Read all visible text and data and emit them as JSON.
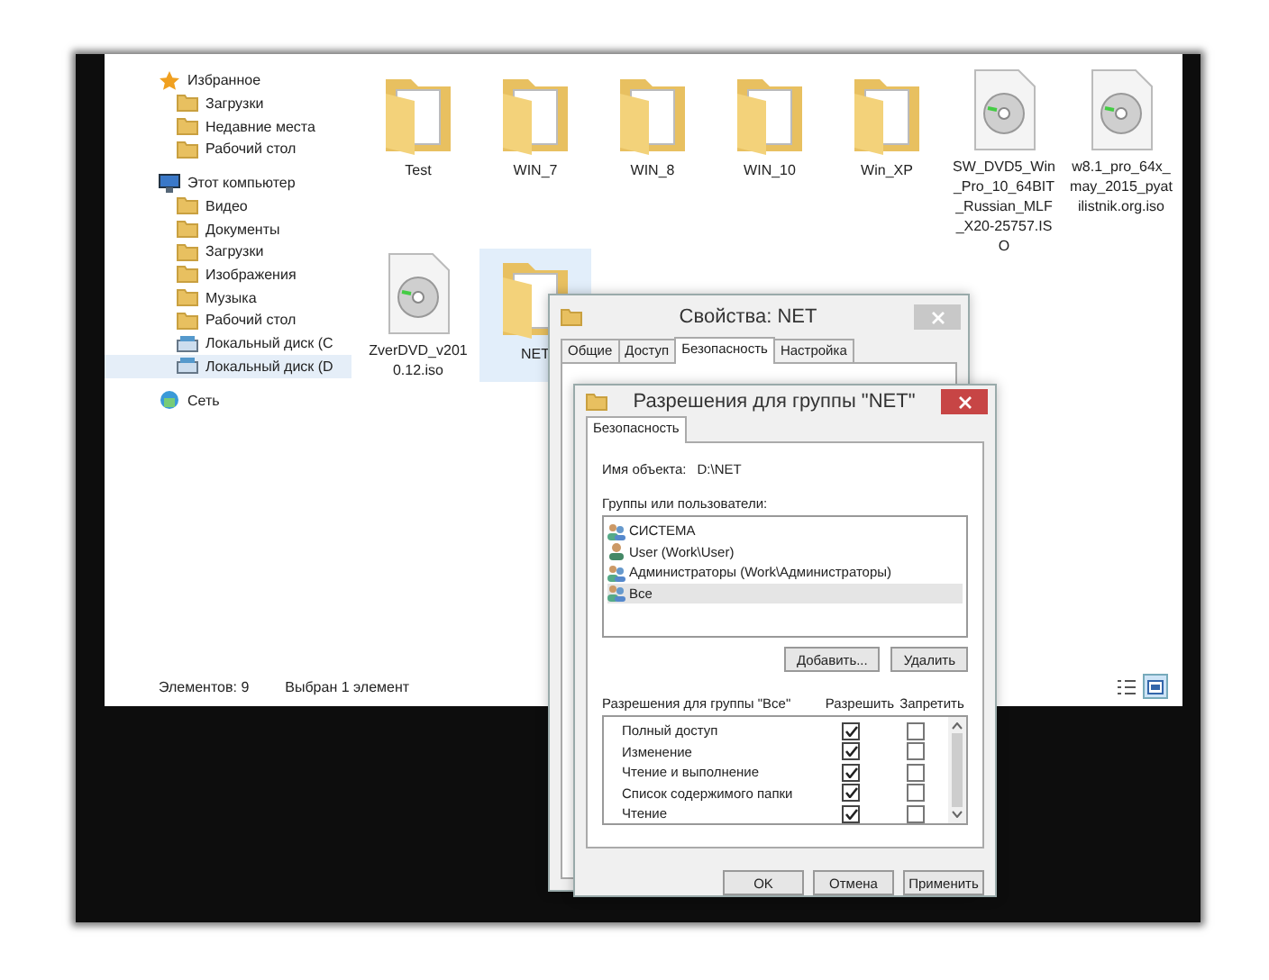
{
  "explorer": {
    "sidebar": [
      {
        "label": "Избранное",
        "children": [
          {
            "label": "Загрузки",
            "kind": "folder",
            "selected": false
          },
          {
            "label": "Недавние места",
            "kind": "folder",
            "selected": false
          },
          {
            "label": "Рабочий стол",
            "kind": "folder",
            "selected": false
          }
        ]
      },
      {
        "label": "Этот компьютер",
        "children": [
          {
            "label": "Видео",
            "kind": "folder",
            "selected": false
          },
          {
            "label": "Документы",
            "kind": "folder",
            "selected": false
          },
          {
            "label": "Загрузки",
            "kind": "folder",
            "selected": false
          },
          {
            "label": "Изображения",
            "kind": "folder",
            "selected": false
          },
          {
            "label": "Музыка",
            "kind": "folder",
            "selected": false
          },
          {
            "label": "Рабочий стол",
            "kind": "folder",
            "selected": false
          },
          {
            "label": "Локальный диск (C",
            "kind": "drive",
            "selected": false
          },
          {
            "label": "Локальный диск (D",
            "kind": "drive",
            "selected": true
          }
        ]
      },
      {
        "label": "Сеть"
      }
    ],
    "files": [
      {
        "name": "Test",
        "kind": "folder",
        "selected": false
      },
      {
        "name": "WIN_7",
        "kind": "folder",
        "selected": false
      },
      {
        "name": "WIN_8",
        "kind": "folder",
        "selected": false
      },
      {
        "name": "WIN_10",
        "kind": "folder",
        "selected": false
      },
      {
        "name": "Win_XP",
        "kind": "folder",
        "selected": false
      },
      {
        "name": "SW_DVD5_Win_Pro_10_64BIT_Russian_MLF_X20-25757.ISO",
        "kind": "disc",
        "selected": false
      },
      {
        "name": "w8.1_pro_64x_may_2015_pyatilistnik.org.iso",
        "kind": "disc",
        "selected": false
      },
      {
        "name": "ZverDVD_v2010.12.iso",
        "kind": "disc",
        "selected": false
      },
      {
        "name": "NET",
        "kind": "folder",
        "selected": true
      }
    ],
    "status_bar": {
      "count": "Элементов: 9",
      "selection": "Выбран 1 элемент"
    }
  },
  "properties_dialog": {
    "title": "Свойства: NET",
    "tabs": [
      {
        "label": "Общие",
        "selected": false
      },
      {
        "label": "Доступ",
        "selected": false
      },
      {
        "label": "Безопасность",
        "selected": true
      },
      {
        "label": "Настройка",
        "selected": false
      }
    ]
  },
  "permissions_dialog": {
    "title": "Разрешения для группы \"NET\"",
    "tabs": [
      {
        "label": "Безопасность",
        "selected": true
      }
    ],
    "object_label": "Имя объекта:",
    "object_name": "D:\\NET",
    "groups_label": "Группы или пользователи:",
    "groups": [
      {
        "name": "СИСТЕМА",
        "kind": "group",
        "selected": false
      },
      {
        "name": "User (Work\\User)",
        "kind": "user",
        "selected": false
      },
      {
        "name": "Администраторы (Work\\Администраторы)",
        "kind": "group",
        "selected": false
      },
      {
        "name": "Все",
        "kind": "group",
        "selected": true
      }
    ],
    "add_button": "Добавить...",
    "remove_button": "Удалить",
    "permissions_label": "Разрешения для группы \"Все\"",
    "allow_header": "Разрешить",
    "deny_header": "Запретить",
    "permissions": [
      {
        "name": "Полный доступ",
        "allow": true,
        "deny": false
      },
      {
        "name": "Изменение",
        "allow": true,
        "deny": false
      },
      {
        "name": "Чтение и выполнение",
        "allow": true,
        "deny": false
      },
      {
        "name": "Список содержимого папки",
        "allow": true,
        "deny": false
      },
      {
        "name": "Чтение",
        "allow": true,
        "deny": false
      }
    ],
    "buttons": [
      "OK",
      "Отмена",
      "Применить"
    ]
  }
}
